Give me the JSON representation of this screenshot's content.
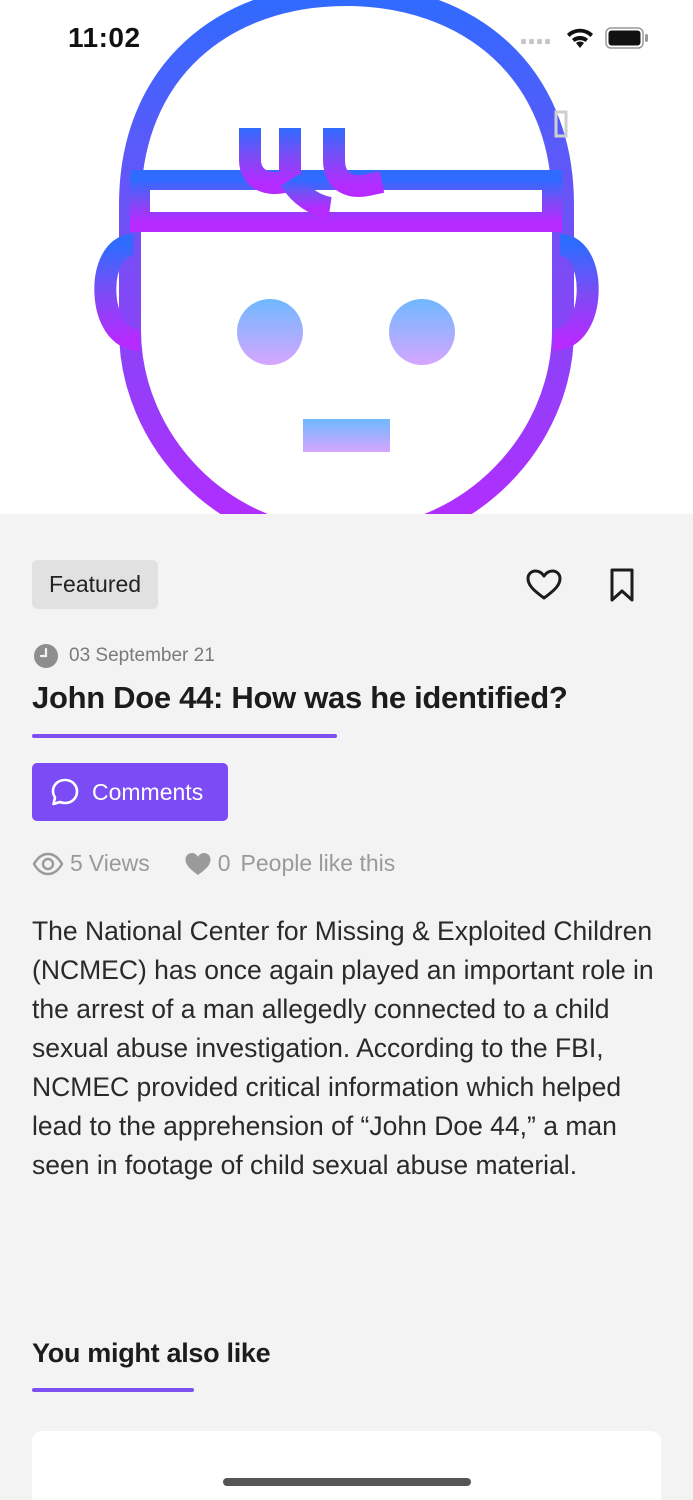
{
  "status_bar": {
    "time": "11:02"
  },
  "article": {
    "badge": "Featured",
    "date": "03 September 21",
    "title": "John Doe 44: How was he identified?",
    "comments_label": "Comments",
    "views_count": "5",
    "views_label": "Views",
    "likes_count": "0",
    "likes_label": "People like this",
    "body": "The National Center for Missing & Exploited Children (NCMEC) has once again played an important role in the arrest of a man allegedly connected to a child sexual abuse investigation. According to the FBI, NCMEC provided critical information which helped lead to the apprehension of “John Doe 44,” a man seen in footage of child sexual abuse material."
  },
  "related": {
    "title": "You might also like"
  },
  "colors": {
    "accent": "#7b4cf5",
    "illustration_top": "#3a6cff",
    "illustration_bottom": "#b52bff"
  },
  "icons": {
    "hero": "face-illustration-icon",
    "signal": "signal-icon",
    "wifi": "wifi-icon",
    "battery": "battery-icon",
    "like": "heart-outline-icon",
    "bookmark": "bookmark-icon",
    "clock": "clock-icon",
    "comment": "chat-bubble-icon",
    "views": "eye-icon",
    "likes": "heart-filled-icon"
  }
}
